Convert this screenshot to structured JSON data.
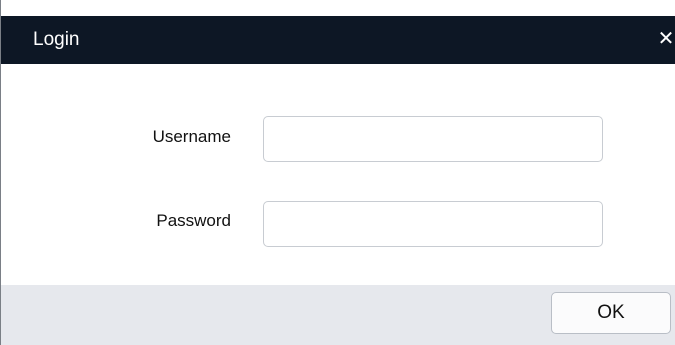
{
  "dialog": {
    "title": "Login",
    "close_icon": "close-icon"
  },
  "form": {
    "username_label": "Username",
    "username_value": "",
    "password_label": "Password",
    "password_value": ""
  },
  "footer": {
    "ok_label": "OK"
  },
  "colors": {
    "titlebar": "#0d1725",
    "footer": "#e6e8ed"
  }
}
